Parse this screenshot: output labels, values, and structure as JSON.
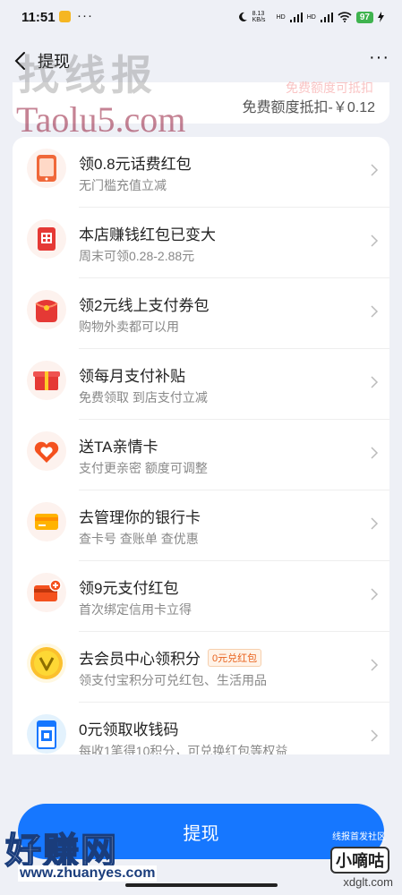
{
  "status_bar": {
    "time": "11:51",
    "more": "···",
    "net_speed": "8.13 KB/s",
    "signal_1": "HD",
    "signal_2": "HD",
    "battery": "97"
  },
  "nav": {
    "title": "提现",
    "more": "···"
  },
  "top_card": {
    "faded_text": "免费额度可抵扣",
    "deduct": "免费额度抵扣-￥0.12"
  },
  "list": [
    {
      "title": "领0.8元话费红包",
      "subtitle": "无门槛充值立减",
      "icon": "phone-icon"
    },
    {
      "title": "本店赚钱红包已变大",
      "subtitle": "周末可领0.28-2.88元",
      "icon": "red-envelope-qr-icon"
    },
    {
      "title": "领2元线上支付券包",
      "subtitle": "购物外卖都可以用",
      "icon": "coupon-bag-icon"
    },
    {
      "title": "领每月支付补贴",
      "subtitle": "免费领取 到店支付立减",
      "icon": "gift-box-icon"
    },
    {
      "title": "送TA亲情卡",
      "subtitle": "支付更亲密 额度可调整",
      "icon": "heart-card-icon"
    },
    {
      "title": "去管理你的银行卡",
      "subtitle": "查卡号 查账单 查优惠",
      "icon": "bank-card-icon"
    },
    {
      "title": "领9元支付红包",
      "subtitle": "首次绑定信用卡立得",
      "icon": "credit-card-add-icon"
    },
    {
      "title": "去会员中心领积分",
      "tag": "0元兑红包",
      "subtitle": "领支付宝积分可兑红包、生活用品",
      "icon": "vip-badge-icon"
    },
    {
      "title": "0元领取收钱码",
      "subtitle": "每收1笔得10积分，可兑换红包等权益",
      "icon": "qr-code-stand-icon"
    }
  ],
  "withdraw_button": "提现",
  "watermarks": {
    "top_left": "找线报",
    "taolu": "Taolu5.com",
    "haozhuan": "好赚网",
    "haozhuan_url": "www.zhuanyes.com",
    "xianbao": "线报首发社区",
    "xiaodigu": "小嘀咕",
    "xdglt": "xdglt.com"
  },
  "colors": {
    "accent": "#1677ff",
    "page_bg": "#eef0f6",
    "card_bg": "#ffffff",
    "tag_orange": "#e8611c"
  }
}
